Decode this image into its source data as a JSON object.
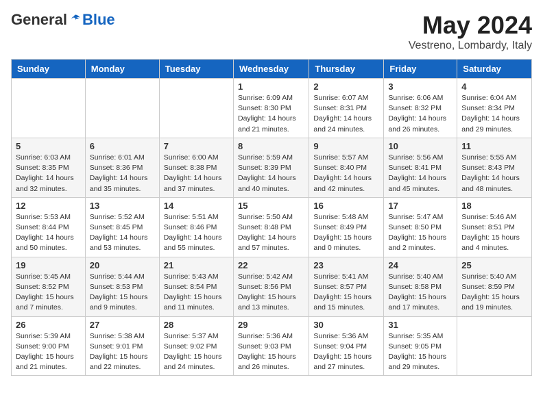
{
  "header": {
    "logo_general": "General",
    "logo_blue": "Blue",
    "month_title": "May 2024",
    "location": "Vestreno, Lombardy, Italy"
  },
  "columns": [
    "Sunday",
    "Monday",
    "Tuesday",
    "Wednesday",
    "Thursday",
    "Friday",
    "Saturday"
  ],
  "weeks": [
    [
      {
        "day": "",
        "info": ""
      },
      {
        "day": "",
        "info": ""
      },
      {
        "day": "",
        "info": ""
      },
      {
        "day": "1",
        "info": "Sunrise: 6:09 AM\nSunset: 8:30 PM\nDaylight: 14 hours\nand 21 minutes."
      },
      {
        "day": "2",
        "info": "Sunrise: 6:07 AM\nSunset: 8:31 PM\nDaylight: 14 hours\nand 24 minutes."
      },
      {
        "day": "3",
        "info": "Sunrise: 6:06 AM\nSunset: 8:32 PM\nDaylight: 14 hours\nand 26 minutes."
      },
      {
        "day": "4",
        "info": "Sunrise: 6:04 AM\nSunset: 8:34 PM\nDaylight: 14 hours\nand 29 minutes."
      }
    ],
    [
      {
        "day": "5",
        "info": "Sunrise: 6:03 AM\nSunset: 8:35 PM\nDaylight: 14 hours\nand 32 minutes."
      },
      {
        "day": "6",
        "info": "Sunrise: 6:01 AM\nSunset: 8:36 PM\nDaylight: 14 hours\nand 35 minutes."
      },
      {
        "day": "7",
        "info": "Sunrise: 6:00 AM\nSunset: 8:38 PM\nDaylight: 14 hours\nand 37 minutes."
      },
      {
        "day": "8",
        "info": "Sunrise: 5:59 AM\nSunset: 8:39 PM\nDaylight: 14 hours\nand 40 minutes."
      },
      {
        "day": "9",
        "info": "Sunrise: 5:57 AM\nSunset: 8:40 PM\nDaylight: 14 hours\nand 42 minutes."
      },
      {
        "day": "10",
        "info": "Sunrise: 5:56 AM\nSunset: 8:41 PM\nDaylight: 14 hours\nand 45 minutes."
      },
      {
        "day": "11",
        "info": "Sunrise: 5:55 AM\nSunset: 8:43 PM\nDaylight: 14 hours\nand 48 minutes."
      }
    ],
    [
      {
        "day": "12",
        "info": "Sunrise: 5:53 AM\nSunset: 8:44 PM\nDaylight: 14 hours\nand 50 minutes."
      },
      {
        "day": "13",
        "info": "Sunrise: 5:52 AM\nSunset: 8:45 PM\nDaylight: 14 hours\nand 53 minutes."
      },
      {
        "day": "14",
        "info": "Sunrise: 5:51 AM\nSunset: 8:46 PM\nDaylight: 14 hours\nand 55 minutes."
      },
      {
        "day": "15",
        "info": "Sunrise: 5:50 AM\nSunset: 8:48 PM\nDaylight: 14 hours\nand 57 minutes."
      },
      {
        "day": "16",
        "info": "Sunrise: 5:48 AM\nSunset: 8:49 PM\nDaylight: 15 hours\nand 0 minutes."
      },
      {
        "day": "17",
        "info": "Sunrise: 5:47 AM\nSunset: 8:50 PM\nDaylight: 15 hours\nand 2 minutes."
      },
      {
        "day": "18",
        "info": "Sunrise: 5:46 AM\nSunset: 8:51 PM\nDaylight: 15 hours\nand 4 minutes."
      }
    ],
    [
      {
        "day": "19",
        "info": "Sunrise: 5:45 AM\nSunset: 8:52 PM\nDaylight: 15 hours\nand 7 minutes."
      },
      {
        "day": "20",
        "info": "Sunrise: 5:44 AM\nSunset: 8:53 PM\nDaylight: 15 hours\nand 9 minutes."
      },
      {
        "day": "21",
        "info": "Sunrise: 5:43 AM\nSunset: 8:54 PM\nDaylight: 15 hours\nand 11 minutes."
      },
      {
        "day": "22",
        "info": "Sunrise: 5:42 AM\nSunset: 8:56 PM\nDaylight: 15 hours\nand 13 minutes."
      },
      {
        "day": "23",
        "info": "Sunrise: 5:41 AM\nSunset: 8:57 PM\nDaylight: 15 hours\nand 15 minutes."
      },
      {
        "day": "24",
        "info": "Sunrise: 5:40 AM\nSunset: 8:58 PM\nDaylight: 15 hours\nand 17 minutes."
      },
      {
        "day": "25",
        "info": "Sunrise: 5:40 AM\nSunset: 8:59 PM\nDaylight: 15 hours\nand 19 minutes."
      }
    ],
    [
      {
        "day": "26",
        "info": "Sunrise: 5:39 AM\nSunset: 9:00 PM\nDaylight: 15 hours\nand 21 minutes."
      },
      {
        "day": "27",
        "info": "Sunrise: 5:38 AM\nSunset: 9:01 PM\nDaylight: 15 hours\nand 22 minutes."
      },
      {
        "day": "28",
        "info": "Sunrise: 5:37 AM\nSunset: 9:02 PM\nDaylight: 15 hours\nand 24 minutes."
      },
      {
        "day": "29",
        "info": "Sunrise: 5:36 AM\nSunset: 9:03 PM\nDaylight: 15 hours\nand 26 minutes."
      },
      {
        "day": "30",
        "info": "Sunrise: 5:36 AM\nSunset: 9:04 PM\nDaylight: 15 hours\nand 27 minutes."
      },
      {
        "day": "31",
        "info": "Sunrise: 5:35 AM\nSunset: 9:05 PM\nDaylight: 15 hours\nand 29 minutes."
      },
      {
        "day": "",
        "info": ""
      }
    ]
  ]
}
